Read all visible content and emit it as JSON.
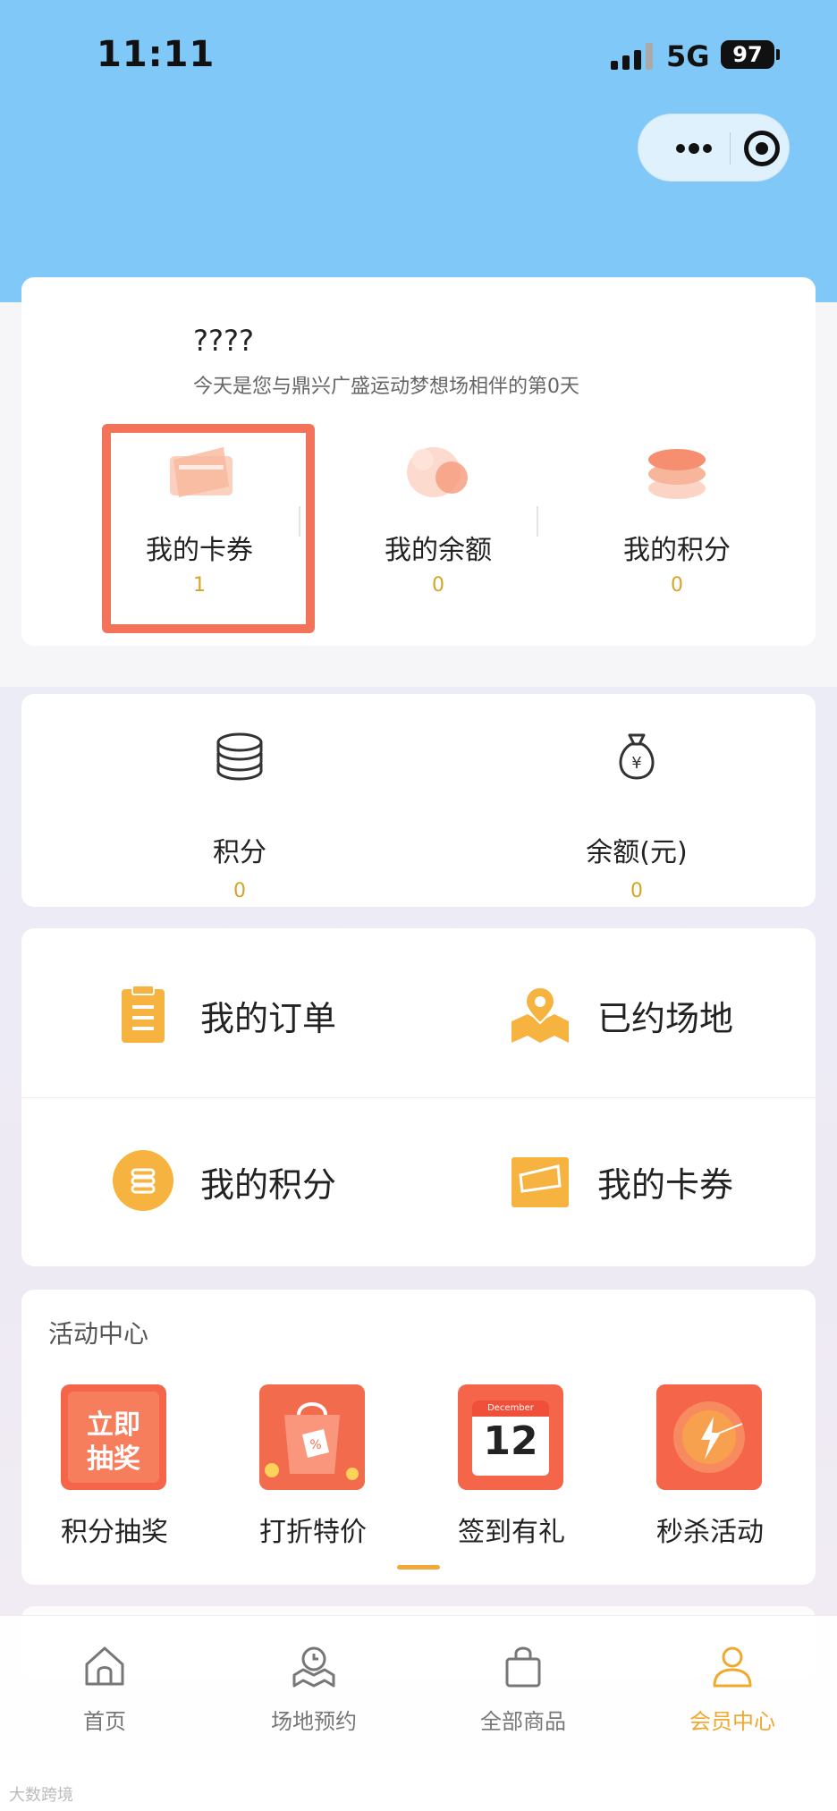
{
  "status_bar": {
    "time": "11:11",
    "network": "5G",
    "battery": "97"
  },
  "profile": {
    "username": "????",
    "motto": "今天是您与鼎兴广盛运动梦想场相伴的第0天",
    "stats": [
      {
        "label": "我的卡券",
        "value": "1",
        "icon": "card-icon"
      },
      {
        "label": "我的余额",
        "value": "0",
        "icon": "wallet-icon"
      },
      {
        "label": "我的积分",
        "value": "0",
        "icon": "coins-icon"
      }
    ]
  },
  "balances": [
    {
      "label": "积分",
      "value": "0",
      "icon": "coin-stack-icon"
    },
    {
      "label": "余额(元)",
      "value": "0",
      "icon": "money-bag-icon"
    }
  ],
  "menu": [
    {
      "label": "我的订单",
      "icon": "order-icon"
    },
    {
      "label": "已约场地",
      "icon": "map-pin-icon"
    },
    {
      "label": "我的积分",
      "icon": "points-icon"
    },
    {
      "label": "我的卡券",
      "icon": "coupon-icon"
    }
  ],
  "activity": {
    "title": "活动中心",
    "items": [
      {
        "label": "积分抽奖",
        "tile_text_1": "立即",
        "tile_text_2": "抽奖"
      },
      {
        "label": "打折特价"
      },
      {
        "label": "签到有礼",
        "month": "December",
        "day": "12"
      },
      {
        "label": "秒杀活动"
      }
    ]
  },
  "tabbar": [
    {
      "label": "首页",
      "icon": "home-icon",
      "active": false
    },
    {
      "label": "场地预约",
      "icon": "booking-icon",
      "active": false
    },
    {
      "label": "全部商品",
      "icon": "bag-icon",
      "active": false
    },
    {
      "label": "会员中心",
      "icon": "member-icon",
      "active": true
    }
  ],
  "watermark": "大数跨境",
  "colors": {
    "accent": "#f0a92e",
    "value": "#d6a427",
    "header": "#80c8f8",
    "highlight": "#f3725a"
  }
}
